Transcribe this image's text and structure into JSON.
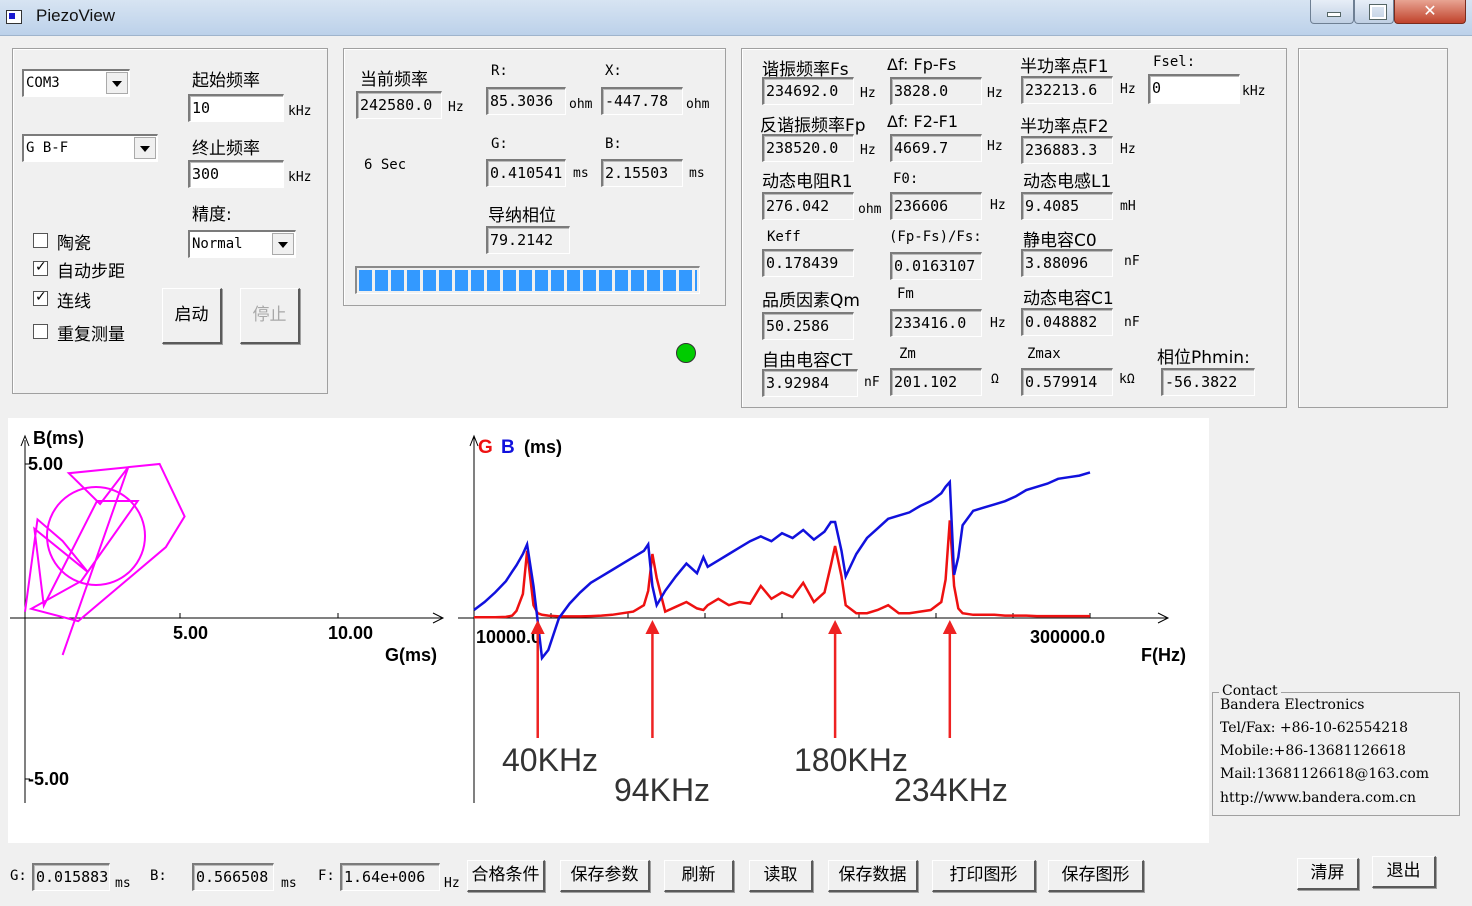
{
  "window": {
    "title": "PiezoView",
    "close_glyph": "✕"
  },
  "left": {
    "port": "COM3",
    "mode": "G B-F",
    "start_freq_label": "起始频率",
    "start_freq_value": "10",
    "start_freq_unit": "kHz",
    "end_freq_label": "终止频率",
    "end_freq_value": "300",
    "end_freq_unit": "kHz",
    "precision_label": "精度:",
    "precision_value": "Normal",
    "checkboxes": [
      {
        "label": "陶瓷",
        "checked": false
      },
      {
        "label": "自动步距",
        "checked": true
      },
      {
        "label": "连线",
        "checked": true
      },
      {
        "label": "重复测量",
        "checked": false
      }
    ],
    "check_glyph": "✓",
    "start_button": "启动",
    "stop_button": "停止"
  },
  "middle": {
    "cur_freq_label": "当前频率",
    "cur_freq_value": "242580.0",
    "cur_freq_unit": "Hz",
    "r_label": "R:",
    "r_value": "85.3036",
    "r_unit": "ohm",
    "x_label": "X:",
    "x_value": "-447.78",
    "x_unit": "ohm",
    "g_label": "G:",
    "g_value": "0.410541",
    "g_unit": "ms",
    "b_label": "B:",
    "b_value": "2.15503",
    "b_unit": "ms",
    "sec_label": "6 Sec",
    "phase_label": "导纳相位",
    "phase_value": "79.2142",
    "progress_fraction": 1.0,
    "status_led_color": "#00cc00"
  },
  "params": {
    "fs_label": "谐振频率Fs",
    "fs_value": "234692.0",
    "fs_unit": "Hz",
    "dfs_label": "Δf: Fp-Fs",
    "dfs_value": "3828.0",
    "dfs_unit": "Hz",
    "f1_label": "半功率点F1",
    "f1_value": "232213.6",
    "f1_unit": "Hz",
    "fsel_label": "Fsel:",
    "fsel_value": "0",
    "fsel_unit": "kHz",
    "fp_label": "反谐振频率Fp",
    "fp_value": "238520.0",
    "fp_unit": "Hz",
    "df21_label": "Δf: F2-F1",
    "df21_value": "4669.7",
    "df21_unit": "Hz",
    "f2_label": "半功率点F2",
    "f2_value": "236883.3",
    "f2_unit": "Hz",
    "r1_label": "动态电阻R1",
    "r1_value": "276.042",
    "r1_unit": "ohm",
    "f0_label": "F0:",
    "f0_value": "236606",
    "f0_unit": "Hz",
    "l1_label": "动态电感L1",
    "l1_value": "9.4085",
    "l1_unit": "mH",
    "keff_label": "Keff",
    "keff_value": "0.178439",
    "fpfs_label": "(Fp-Fs)/Fs:",
    "fpfs_value": "0.0163107",
    "c0_label": "静电容C0",
    "c0_value": "3.88096",
    "c0_unit": "nF",
    "qm_label": "品质因素Qm",
    "qm_value": "50.2586",
    "fm_label": "Fm",
    "fm_value": "233416.0",
    "fm_unit": "Hz",
    "c1_label": "动态电容C1",
    "c1_value": "0.048882",
    "c1_unit": "nF",
    "ct_label": "自由电容CT",
    "ct_value": "3.92984",
    "ct_unit": "nF",
    "zm_label": "Zm",
    "zm_value": "201.102",
    "zm_unit": "Ω",
    "zmax_label": "Zmax",
    "zmax_value": "0.579914",
    "zmax_unit": "kΩ",
    "phmin_label": "相位Phmin:",
    "phmin_value": "-56.3822"
  },
  "admittance_plot": {
    "y_axis_label": "B(ms)",
    "y_top": "5.00",
    "y_bottom": "-5.00",
    "x_ticks": [
      "5.00",
      "10.00"
    ],
    "x_axis_label": "G(ms)",
    "color": "#ff00ff"
  },
  "sweep_plot": {
    "legend_g": "G",
    "legend_b": "B",
    "legend_unit": "(ms)",
    "x_left": "10000.0",
    "x_right": "300000.0",
    "x_axis_label": "F(Hz)",
    "g_color": "#ee1111",
    "b_color": "#1111dd",
    "annotation_color": "#ee2222",
    "annotations": [
      "40KHz",
      "94KHz",
      "180KHz",
      "234KHz"
    ]
  },
  "chart_data": [
    {
      "type": "line",
      "x": [
        0.0,
        0.4,
        1.2,
        2.0,
        0.3,
        0.6,
        2.3,
        3.6,
        1.8,
        0.2,
        1.7,
        4.5,
        5.1,
        4.3,
        1.4,
        2.4,
        3.3,
        1.2
      ],
      "y": [
        0.2,
        3.2,
        2.5,
        1.5,
        2.9,
        0.4,
        3.8,
        3.8,
        1.2,
        0.3,
        -0.1,
        2.3,
        3.3,
        5.0,
        4.7,
        3.7,
        4.9,
        -1.2
      ],
      "xlabel": "G(ms)",
      "ylabel": "B(ms)",
      "xlim": [
        0,
        12.5
      ],
      "ylim": [
        -5,
        5
      ]
    },
    {
      "type": "line",
      "x": [
        10,
        15,
        20,
        25,
        28,
        30,
        33,
        35,
        38,
        40,
        42,
        45,
        50,
        55,
        60,
        65,
        70,
        75,
        80,
        85,
        90,
        92,
        94,
        96,
        100,
        105,
        110,
        115,
        118,
        120,
        125,
        130,
        135,
        140,
        145,
        150,
        155,
        160,
        165,
        170,
        175,
        178,
        180,
        183,
        185,
        190,
        195,
        200,
        205,
        210,
        215,
        220,
        225,
        230,
        232,
        234,
        236,
        238,
        240,
        245,
        250,
        255,
        260,
        265,
        270,
        275,
        280,
        285,
        290,
        295,
        300
      ],
      "series": [
        {
          "name": "G",
          "values": [
            0.05,
            0.05,
            0.05,
            0.07,
            0.15,
            0.45,
            1.5,
            4.2,
            0.8,
            0.3,
            0.2,
            0.15,
            0.1,
            0.1,
            0.1,
            0.12,
            0.15,
            0.2,
            0.3,
            0.4,
            0.8,
            1.7,
            4.0,
            2.5,
            0.4,
            0.7,
            1.0,
            0.6,
            0.5,
            0.8,
            1.2,
            0.8,
            1.0,
            0.9,
            2.0,
            1.2,
            1.6,
            1.3,
            2.2,
            1.0,
            1.6,
            3.3,
            4.5,
            2.6,
            0.8,
            0.3,
            0.3,
            0.5,
            0.8,
            0.3,
            0.3,
            0.4,
            0.5,
            1.0,
            2.4,
            6.1,
            2.0,
            0.6,
            0.3,
            0.2,
            0.2,
            0.2,
            0.15,
            0.15,
            0.15,
            0.12,
            0.12,
            0.12,
            0.12,
            0.12,
            0.12
          ]
        },
        {
          "name": "B",
          "values": [
            0.5,
            1.0,
            1.6,
            2.3,
            2.9,
            3.3,
            4.0,
            4.6,
            2.0,
            -0.2,
            -2.5,
            -2.0,
            0.0,
            0.9,
            1.6,
            2.2,
            2.6,
            3.0,
            3.4,
            3.8,
            4.2,
            4.6,
            2.0,
            0.8,
            1.7,
            2.6,
            3.4,
            2.8,
            3.8,
            3.2,
            3.6,
            4.0,
            4.4,
            4.8,
            5.1,
            4.8,
            5.3,
            5.0,
            5.5,
            4.9,
            5.4,
            6.0,
            6.0,
            4.2,
            2.6,
            4.0,
            5.0,
            5.6,
            6.2,
            6.4,
            6.6,
            7.0,
            7.3,
            7.8,
            8.2,
            8.5,
            2.7,
            3.8,
            5.8,
            6.7,
            6.9,
            7.1,
            7.3,
            7.6,
            8.0,
            8.2,
            8.4,
            8.7,
            8.8,
            8.9,
            9.1
          ]
        }
      ],
      "xlabel": "F(Hz)",
      "ylim": [
        -3,
        11
      ],
      "xlim": [
        0,
        330
      ]
    }
  ],
  "contact": {
    "legend": "Contact",
    "lines": [
      "Bandera Electronics",
      "Tel/Fax: +86-10-62554218",
      "Mobile:+86-13681126618",
      "Mail:13681126618@163.com",
      "http://www.bandera.com.cn"
    ]
  },
  "bottom": {
    "g_label": "G:",
    "g_value": "0.015883",
    "g_unit": "ms",
    "b_label": "B:",
    "b_value": "0.566508",
    "b_unit": "ms",
    "f_label": "F:",
    "f_value": "1.64e+006",
    "f_unit": "Hz",
    "buttons": [
      "合格条件",
      "保存参数",
      "刷新",
      "读取",
      "保存数据",
      "打印图形",
      "保存图形"
    ],
    "clear_button": "清屏",
    "exit_button": "退出"
  }
}
